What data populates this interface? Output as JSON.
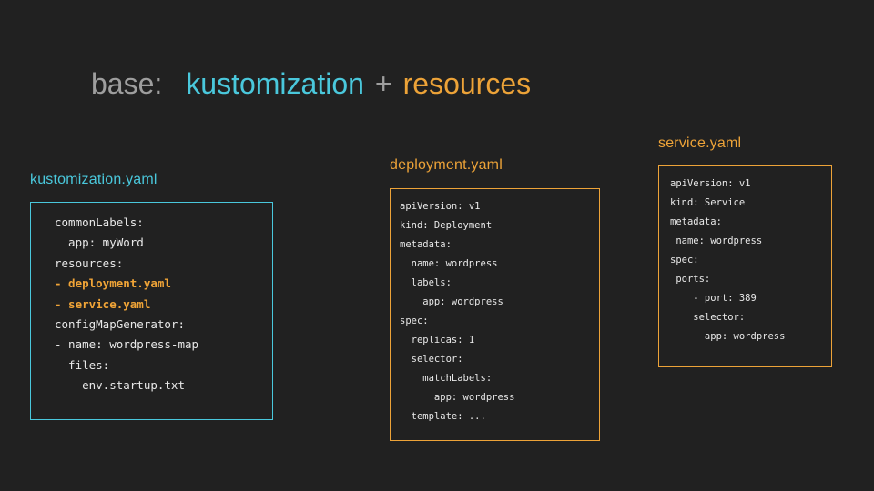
{
  "colors": {
    "background": "#212121",
    "title_gray": "#9e9e9e",
    "cyan": "#4ac8dc",
    "orange": "#eda338",
    "code_text": "#e8e8e8",
    "highlight": "#f0a437"
  },
  "title": {
    "base": "base:",
    "kustomization": "kustomization",
    "plus": "+",
    "resources": "resources"
  },
  "panels": [
    {
      "id": "kustomization",
      "label": "kustomization.yaml",
      "accent": "#4ac8dc",
      "lines": [
        {
          "text": "commonLabels:",
          "hl": false
        },
        {
          "text": "  app: myWord",
          "hl": false
        },
        {
          "text": "resources:",
          "hl": false
        },
        {
          "text": "- deployment.yaml",
          "hl": true
        },
        {
          "text": "- service.yaml",
          "hl": true
        },
        {
          "text": "configMapGenerator:",
          "hl": false
        },
        {
          "text": "- name: wordpress-map",
          "hl": false
        },
        {
          "text": "  files:",
          "hl": false
        },
        {
          "text": "  - env.startup.txt",
          "hl": false
        }
      ]
    },
    {
      "id": "deployment",
      "label": "deployment.yaml",
      "accent": "#eda338",
      "lines": [
        {
          "text": "apiVersion: v1",
          "hl": false
        },
        {
          "text": "kind: Deployment",
          "hl": false
        },
        {
          "text": "metadata:",
          "hl": false
        },
        {
          "text": "  name: wordpress",
          "hl": false
        },
        {
          "text": "  labels:",
          "hl": false
        },
        {
          "text": "    app: wordpress",
          "hl": false
        },
        {
          "text": "spec:",
          "hl": false
        },
        {
          "text": "  replicas: 1",
          "hl": false
        },
        {
          "text": "  selector:",
          "hl": false
        },
        {
          "text": "    matchLabels:",
          "hl": false
        },
        {
          "text": "      app: wordpress",
          "hl": false
        },
        {
          "text": "  template: ...",
          "hl": false
        }
      ]
    },
    {
      "id": "service",
      "label": "service.yaml",
      "accent": "#eda338",
      "lines": [
        {
          "text": "apiVersion: v1",
          "hl": false
        },
        {
          "text": "kind: Service",
          "hl": false
        },
        {
          "text": "metadata:",
          "hl": false
        },
        {
          "text": " name: wordpress",
          "hl": false
        },
        {
          "text": "spec:",
          "hl": false
        },
        {
          "text": " ports:",
          "hl": false
        },
        {
          "text": "    - port: 389",
          "hl": false
        },
        {
          "text": "    selector:",
          "hl": false
        },
        {
          "text": "      app: wordpress",
          "hl": false
        }
      ]
    }
  ]
}
